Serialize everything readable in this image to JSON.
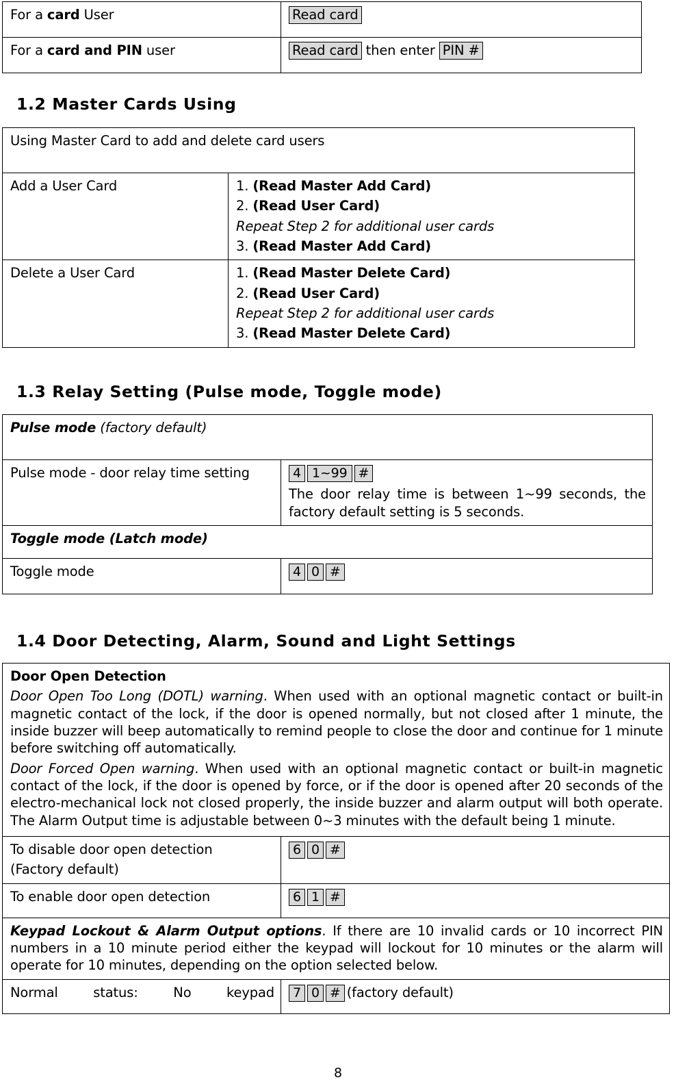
{
  "page": {
    "number": "8",
    "colors": {
      "key_fill": "#d9d9d9",
      "border": "#000000",
      "text": "#000000"
    }
  },
  "table_user_modes": {
    "rows": [
      {
        "label_prefix": "For a ",
        "label_bold": "card",
        "label_suffix": " User",
        "action_keys": [
          "Read card"
        ],
        "action_join": ""
      },
      {
        "label_prefix": "For a ",
        "label_bold": "card and PIN",
        "label_suffix": " user",
        "action_keys": [
          "Read card",
          "PIN #"
        ],
        "action_join": " then enter "
      }
    ]
  },
  "section_1_2": {
    "heading": "1.2 Master Cards Using",
    "table": {
      "caption": "Using Master Card to add and delete card users",
      "rows": [
        {
          "label": "Add a User Card",
          "steps": [
            {
              "num": "1.",
              "text": "(Read Master Add Card)",
              "style": "bold"
            },
            {
              "num": "2.",
              "text": "(Read User Card)",
              "style": "bold"
            },
            {
              "num": "",
              "text": "Repeat Step 2 for additional user cards",
              "style": "italic"
            },
            {
              "num": "3.",
              "text": "(Read Master Add Card)",
              "style": "bold"
            }
          ]
        },
        {
          "label": "Delete a User Card",
          "steps": [
            {
              "num": "1.",
              "text": "(Read Master Delete Card)",
              "style": "bold"
            },
            {
              "num": "2.",
              "text": "(Read User Card)",
              "style": "bold"
            },
            {
              "num": "",
              "text": "Repeat Step 2 for additional user cards",
              "style": "italic"
            },
            {
              "num": "3.",
              "text": "(Read Master Delete Card)",
              "style": "bold"
            }
          ]
        }
      ]
    }
  },
  "section_1_3": {
    "heading": "1.3 Relay Setting (Pulse mode, Toggle mode)",
    "pulse": {
      "caption_bold": "Pulse mode",
      "caption_italic": " (factory default)",
      "row_label": "Pulse mode - door relay time setting",
      "keys": [
        "4",
        "1~99",
        "#"
      ],
      "note": "The door relay time is between 1~99 seconds, the factory default setting is 5 seconds."
    },
    "toggle": {
      "caption": "Toggle mode (Latch mode)",
      "row_label": "Toggle mode",
      "keys": [
        "4",
        "0",
        "#"
      ]
    }
  },
  "section_1_4": {
    "heading": "1.4 Door Detecting, Alarm, Sound and Light Settings",
    "door_open_detection": {
      "title": "Door Open Detection",
      "paragraphs": [
        {
          "lead": "Door Open Too Long (DOTL) warning",
          "body": ". When used with an optional magnetic contact or built-in magnetic contact of the lock, if the door is opened normally, but not closed after 1 minute, the inside buzzer will beep automatically to remind people to close the door and continue for 1 minute before switching off automatically."
        },
        {
          "lead": "Door Forced Open warning",
          "body": ". When used with an optional magnetic contact or built-in magnetic contact of the lock, if the door is opened by force, or if the door is opened after 20 seconds of the electro-mechanical lock not closed properly, the inside buzzer and alarm output will both operate. The Alarm Output time is adjustable between 0~3 minutes with the default being 1 minute."
        }
      ]
    },
    "settings_rows": [
      {
        "label_line1": "To disable door open detection",
        "label_line2": "(Factory default)",
        "keys": [
          "6",
          "0",
          "#"
        ]
      },
      {
        "label_line1": "To enable door open detection",
        "label_line2": "",
        "keys": [
          "6",
          "1",
          "#"
        ]
      }
    ],
    "keypad_lockout": {
      "lead": "Keypad Lockout & Alarm Output options",
      "body": ". If there are 10 invalid cards or 10 incorrect PIN numbers in a 10 minute period either the keypad will lockout for 10 minutes or the alarm will operate for 10 minutes, depending on the option selected below."
    },
    "normal_status_row": {
      "label": "Normal status: No keypad",
      "keys": [
        "7",
        "0",
        "#"
      ],
      "suffix": "(factory default)"
    }
  }
}
